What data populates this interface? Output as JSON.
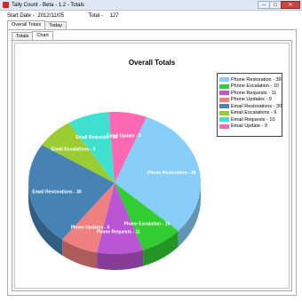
{
  "window": {
    "title": "Tally Count - Beta - 1.2 - Totals",
    "minimize": "–",
    "maximize": "□",
    "close": "✕"
  },
  "info": {
    "start_label": "Start Date -",
    "start_value": "2012/11/05",
    "total_label": "Total -",
    "total_value": "127"
  },
  "outer_tabs": [
    "Overall Totals",
    "Today"
  ],
  "inner_tabs": [
    "Totals",
    "Chart"
  ],
  "chart_data": {
    "type": "pie",
    "title": "Overall Totals",
    "legend_position": "top-right",
    "slices": [
      {
        "label": "Phone Restoration - 39",
        "value": 39,
        "color": "#87cefa"
      },
      {
        "label": "Phone Escalation - 10",
        "value": 10,
        "color": "#32cd32"
      },
      {
        "label": "Phone Requests - 11",
        "value": 11,
        "color": "#ba55d3"
      },
      {
        "label": "Phone Updates - 9",
        "value": 9,
        "color": "#f08080"
      },
      {
        "label": "Email Restorations - 30",
        "value": 30,
        "color": "#4682b4"
      },
      {
        "label": "Email Escalations - 9",
        "value": 9,
        "color": "#9acd32"
      },
      {
        "label": "Email Requests - 10",
        "value": 10,
        "color": "#40e0d0"
      },
      {
        "label": "Email Update - 9",
        "value": 9,
        "color": "#ff69b4"
      }
    ]
  }
}
